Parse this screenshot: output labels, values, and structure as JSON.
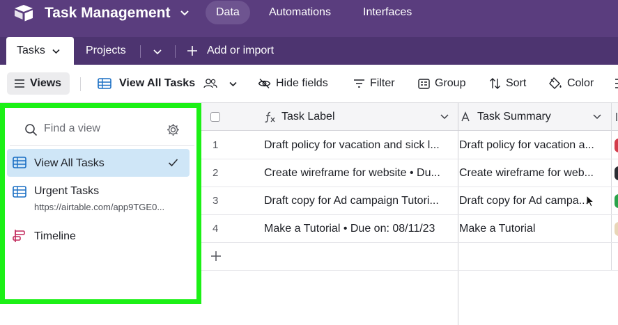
{
  "app": {
    "title": "Task Management",
    "nav": [
      "Data",
      "Automations",
      "Interfaces"
    ],
    "brand_color": "#5a3d7e"
  },
  "tabs": {
    "items": [
      "Tasks",
      "Projects"
    ],
    "add_label": "Add or import"
  },
  "toolbar": {
    "views_label": "Views",
    "current_view": "View All Tasks",
    "hide_fields": "Hide fields",
    "filter": "Filter",
    "group": "Group",
    "sort": "Sort",
    "color": "Color"
  },
  "sidebar": {
    "search_placeholder": "Find a view",
    "views": [
      {
        "name": "View All Tasks",
        "type": "grid",
        "selected": true
      },
      {
        "name": "Urgent Tasks",
        "type": "grid",
        "subtitle": "https://airtable.com/app9TGE0..."
      },
      {
        "name": "Timeline",
        "type": "timeline"
      }
    ],
    "highlight_color": "#1cf016"
  },
  "grid": {
    "columns": [
      "Task Label",
      "Task Summary"
    ],
    "rows": [
      {
        "num": "1",
        "label": "Draft policy for vacation and sick l...",
        "summary": "Draft policy for vacation a..."
      },
      {
        "num": "2",
        "label": "Create wireframe for website • Du...",
        "summary": "Create wireframe for web..."
      },
      {
        "num": "3",
        "label": "Draft copy for Ad campaign Tutori...",
        "summary": "Draft copy for Ad campa..."
      },
      {
        "num": "4",
        "label": "Make a Tutorial • Due on: 08/11/23",
        "summary": "Make a Tutorial"
      }
    ],
    "add_row_icon": "plus-icon"
  }
}
